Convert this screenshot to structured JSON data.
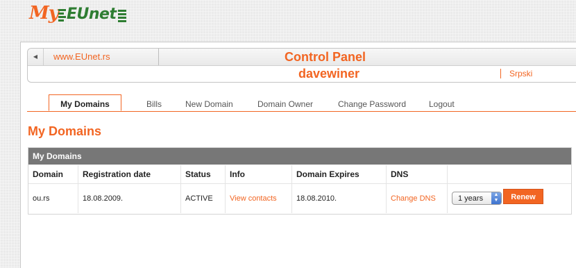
{
  "logo": {
    "my": "My",
    "eunet": "EUnet"
  },
  "header": {
    "url": "www.EUnet.rs",
    "title": "Control Panel",
    "username": "davewiner",
    "language": "Srpski"
  },
  "tabs": [
    {
      "label": "My Domains",
      "active": true
    },
    {
      "label": "Bills"
    },
    {
      "label": "New Domain"
    },
    {
      "label": "Domain Owner"
    },
    {
      "label": "Change Password"
    },
    {
      "label": "Logout"
    }
  ],
  "page_heading": "My Domains",
  "table": {
    "caption": "My Domains",
    "columns": [
      "Domain",
      "Registration date",
      "Status",
      "Info",
      "Domain Expires",
      "DNS",
      ""
    ],
    "rows": [
      {
        "domain": "ou.rs",
        "registration_date": "18.08.2009.",
        "status": "ACTIVE",
        "info": "View contacts",
        "expires": "18.08.2010.",
        "dns": "Change DNS",
        "renew_period": "1 years",
        "renew_label": "Renew"
      }
    ]
  },
  "colors": {
    "accent": "#f26522",
    "logo_green": "#2e7d32",
    "caption_bg": "#777777"
  },
  "icons": {
    "back": "back-arrow-icon",
    "select": "updown-arrows-icon"
  }
}
